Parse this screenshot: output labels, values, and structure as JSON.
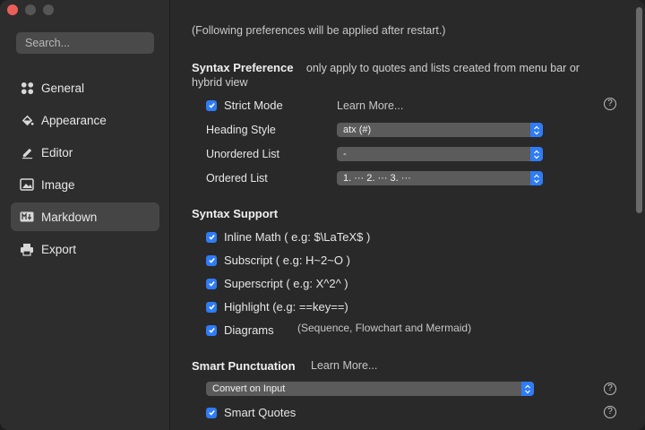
{
  "search": {
    "placeholder": "Search..."
  },
  "sidebar": {
    "items": [
      {
        "label": "General",
        "icon": "grid-icon",
        "active": false
      },
      {
        "label": "Appearance",
        "icon": "paint-bucket-icon",
        "active": false
      },
      {
        "label": "Editor",
        "icon": "pencil-icon",
        "active": false
      },
      {
        "label": "Image",
        "icon": "image-icon",
        "active": false
      },
      {
        "label": "Markdown",
        "icon": "markdown-icon",
        "active": true
      },
      {
        "label": "Export",
        "icon": "printer-icon",
        "active": false
      }
    ]
  },
  "main": {
    "note": "(Following preferences will be applied after restart.)",
    "syntax_preference": {
      "title": "Syntax Preference",
      "subtitle_line1": "only apply to quotes and lists created from menu bar or",
      "subtitle_line2": "hybrid view",
      "strict_mode": {
        "label": "Strict Mode",
        "checked": true
      },
      "learn_more": "Learn More...",
      "heading_style": {
        "label": "Heading Style",
        "value": "atx (#)"
      },
      "unordered_list": {
        "label": "Unordered List",
        "value": "-"
      },
      "ordered_list": {
        "label": "Ordered List",
        "value": "1. ··· 2. ··· 3. ···"
      }
    },
    "syntax_support": {
      "title": "Syntax Support",
      "items": [
        {
          "label": "Inline Math ( e.g: $\\LaTeX$ )",
          "checked": true
        },
        {
          "label": "Subscript ( e.g: H~2~O )",
          "checked": true
        },
        {
          "label": "Superscript ( e.g: X^2^ )",
          "checked": true
        },
        {
          "label": "Highlight (e.g: ==key==)",
          "checked": true
        },
        {
          "label": "Diagrams",
          "checked": true
        }
      ],
      "diagrams_note": "(Sequence, Flowchart and Mermaid)"
    },
    "smart_punctuation": {
      "title": "Smart Punctuation",
      "learn_more": "Learn More...",
      "mode": "Convert on Input",
      "smart_quotes": {
        "label": "Smart Quotes",
        "checked": true
      }
    }
  },
  "colors": {
    "accent": "#2f7cf6",
    "close": "#ec5f58"
  }
}
